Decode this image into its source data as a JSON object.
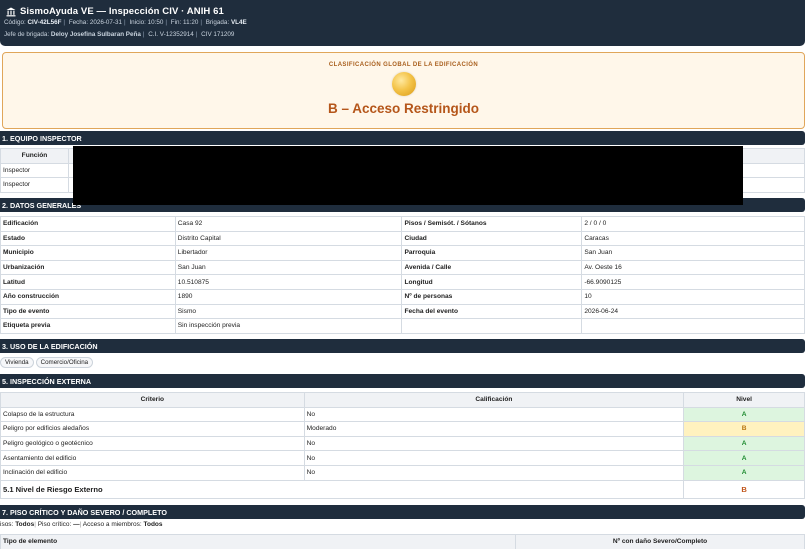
{
  "header": {
    "title": "SismoAyuda VE — Inspección CIV · ANIH 61",
    "meta": {
      "codigo_label": "Código:",
      "codigo": "CIV-42L56F",
      "fecha_label": "Fecha:",
      "fecha": "2026-07-31",
      "inicio_label": "Inicio:",
      "inicio": "10:50",
      "fin_label": "Fin:",
      "fin": "11:20",
      "brigada_label": "Brigada:",
      "brigada": "VL4E"
    },
    "meta2": {
      "jefe_label": "Jefe de brigada:",
      "jefe": "Deloy Josefina Sulbaran Peña",
      "ci_label": "C.I.",
      "ci": "V-12352914",
      "civ_label": "CIV",
      "civ": "171209"
    }
  },
  "classification": {
    "label": "CLASIFICACIÓN GLOBAL DE LA EDIFICACIÓN",
    "value": "B – Acceso Restringido"
  },
  "sections": {
    "s1": "1. EQUIPO INSPECTOR",
    "s2": "2. DATOS GENERALES",
    "s3": "3. USO DE LA EDIFICACIÓN",
    "s5": "5. INSPECCIÓN EXTERNA",
    "s7": "7. PISO CRÍTICO Y DAÑO SEVERO / COMPLETO"
  },
  "team": {
    "col_funcion": "Función",
    "rows": [
      "Inspector",
      "Inspector"
    ]
  },
  "general": [
    [
      "Edificación",
      "Casa 92",
      "Pisos / Semisót. / Sótanos",
      "2 / 0 / 0"
    ],
    [
      "Estado",
      "Distrito Capital",
      "Ciudad",
      "Caracas"
    ],
    [
      "Municipio",
      "Libertador",
      "Parroquia",
      "San Juan"
    ],
    [
      "Urbanización",
      "San Juan",
      "Avenida / Calle",
      "Av. Oeste 16"
    ],
    [
      "Latitud",
      "10.510875",
      "Longitud",
      "-66.9090125"
    ],
    [
      "Año construcción",
      "1890",
      "Nº de personas",
      "10"
    ],
    [
      "Tipo de evento",
      "Sismo",
      "Fecha del evento",
      "2026-06-24"
    ],
    [
      "Etiqueta previa",
      "Sin inspección previa",
      "",
      ""
    ]
  ],
  "uses": [
    "Vivienda",
    "Comercio/Oficina"
  ],
  "external": {
    "col_criterio": "Criterio",
    "col_calificacion": "Calificación",
    "col_nivel": "Nivel",
    "rows": [
      {
        "criterio": "Colapso de la estructura",
        "calificacion": "No",
        "nivel": "A"
      },
      {
        "criterio": "Peligro por edificios aledaños",
        "calificacion": "Moderado",
        "nivel": "B"
      },
      {
        "criterio": "Peligro geológico o geotécnico",
        "calificacion": "No",
        "nivel": "A"
      },
      {
        "criterio": "Asentamiento del edificio",
        "calificacion": "No",
        "nivel": "A"
      },
      {
        "criterio": "Inclinación del edificio",
        "calificacion": "No",
        "nivel": "A"
      }
    ],
    "risk_label": "5.1 Nivel de Riesgo Externo",
    "risk_value": "B"
  },
  "critical": {
    "pisos_label": "isos:",
    "pisos": "Todos",
    "piso_critico_label": "Piso crítico:",
    "piso_critico": "—",
    "acceso_label": "Acceso a miembros:",
    "acceso": "Todos",
    "col_tipo": "Tipo de elemento",
    "col_n": "Nº con daño Severo/Completo"
  },
  "colors": {
    "header_bg": "#1f2d3d",
    "accent": "#b5561a",
    "level_a": "#1d8a2f",
    "level_b": "#b97711"
  }
}
